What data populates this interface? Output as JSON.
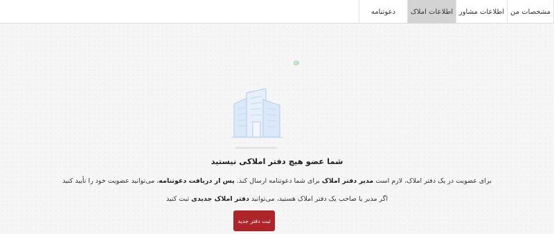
{
  "tabs": [
    {
      "label": "مشخصات من"
    },
    {
      "label": "اطلاعات مشاور"
    },
    {
      "label": "اطلاعات املاک",
      "active": true
    },
    {
      "label": "دعوتنامه"
    }
  ],
  "empty_state": {
    "illustration": "building-icon",
    "title": "شما عضو هیچ دفتر املاکی نیستید",
    "line1": {
      "part1": "برای عضویت در یک دفتر املاک، لازم است ",
      "bold1": "مدیر دفتر املاک",
      "part2": " برای شما دعوتنامه ارسال کند. ",
      "bold2": "پس از دریافت دعوتنامه",
      "part3": "، می‌توانید عضویت خود را تأیید کنید"
    },
    "line2": {
      "part1": "اگر مدیر یا صاحب یک دفتر املاک هستید، می‌توانید ",
      "bold1": "دفتر املاک جدیدی",
      "part2": " ثبت کنید"
    },
    "button_label": "ثبت دفتر جدید"
  },
  "colors": {
    "accent": "#ad2429",
    "active_tab": "#d3d3d3",
    "illustration": "#cfe0f5"
  }
}
